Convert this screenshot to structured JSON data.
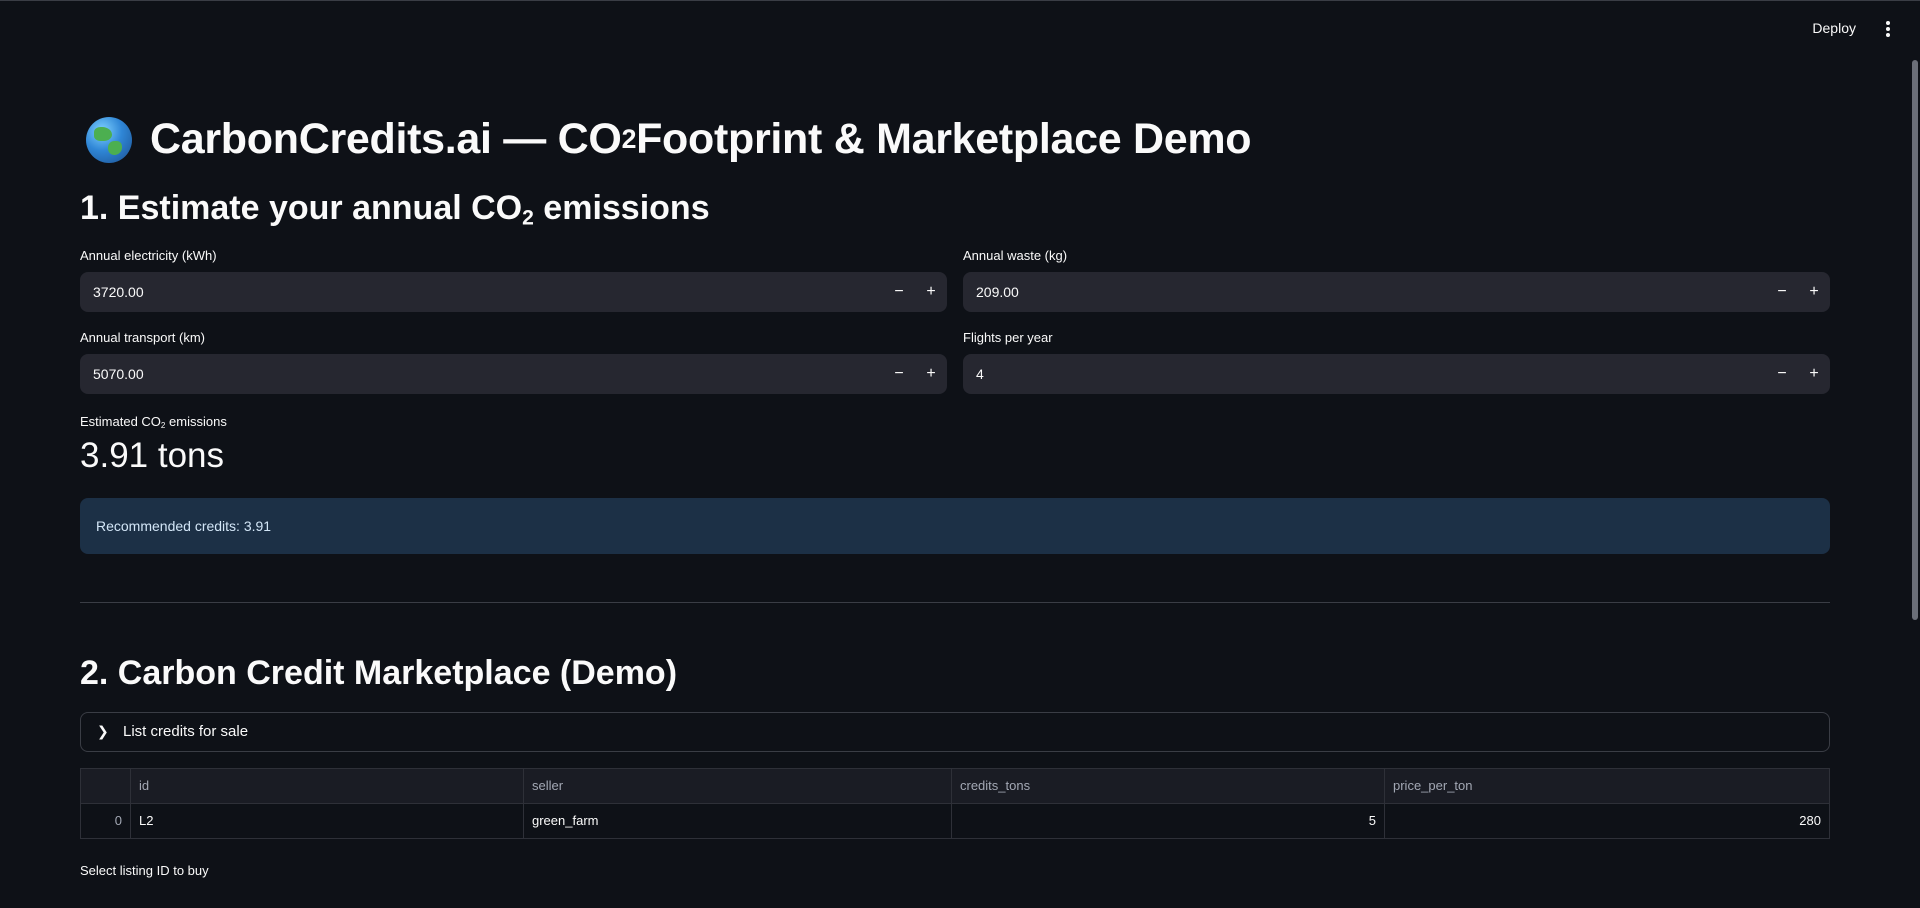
{
  "header": {
    "deploy_label": "Deploy",
    "menu_icon": "kebab-menu-icon"
  },
  "page": {
    "title_prefix": "CarbonCredits.ai — CO",
    "title_sub": "2",
    "title_suffix": " Footprint & Marketplace Demo",
    "title_icon": "globe-icon"
  },
  "section1": {
    "heading_prefix": "1. Estimate your annual CO",
    "heading_sub": "2",
    "heading_suffix": " emissions",
    "inputs": [
      {
        "label": "Annual electricity (kWh)",
        "value": "3720.00"
      },
      {
        "label": "Annual waste (kg)",
        "value": "209.00"
      },
      {
        "label": "Annual transport (km)",
        "value": "5070.00"
      },
      {
        "label": "Flights per year",
        "value": "4"
      }
    ],
    "stepper_minus": "−",
    "stepper_plus": "+",
    "metric_label_prefix": "Estimated CO",
    "metric_label_sub": "2",
    "metric_label_suffix": " emissions",
    "metric_value": "3.91 tons",
    "info_text": "Recommended credits: 3.91"
  },
  "section2": {
    "heading": "2. Carbon Credit Marketplace (Demo)",
    "expander_label": "List credits for sale",
    "table": {
      "columns": [
        "",
        "id",
        "seller",
        "credits_tons",
        "price_per_ton"
      ],
      "rows": [
        {
          "index": "0",
          "id": "L2",
          "seller": "green_farm",
          "credits_tons": "5",
          "price_per_ton": "280"
        }
      ]
    },
    "select_label": "Select listing ID to buy"
  },
  "colors": {
    "background": "#0e1117",
    "input_bg": "#262730",
    "info_bg": "#1c3046",
    "info_text": "#d3e6f7"
  }
}
